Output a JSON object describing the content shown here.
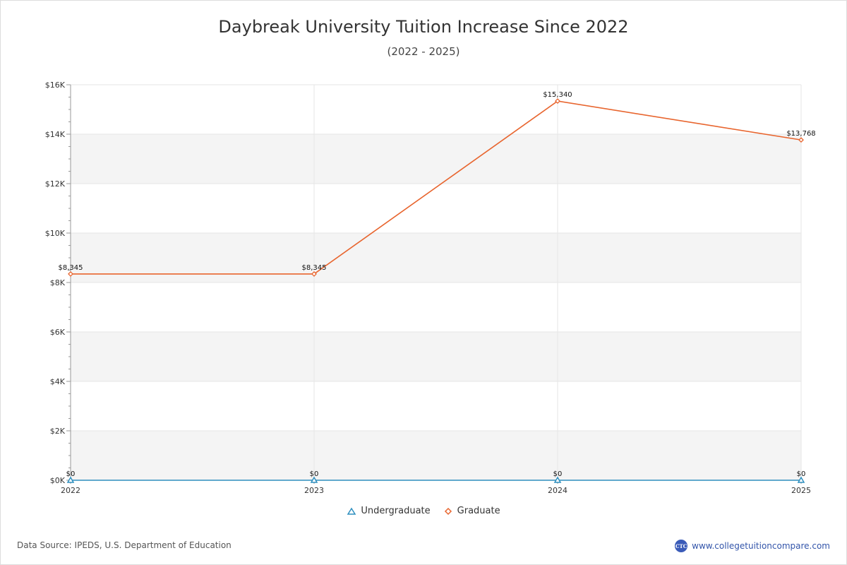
{
  "chart_data": {
    "type": "line",
    "title": "Daybreak University Tuition Increase Since 2022",
    "subtitle": "(2022 - 2025)",
    "x": [
      "2022",
      "2023",
      "2024",
      "2025"
    ],
    "ylim": [
      0,
      16000
    ],
    "y_ticks": [
      "$0K",
      "$2K",
      "$4K",
      "$6K",
      "$8K",
      "$10K",
      "$12K",
      "$14K",
      "$16K"
    ],
    "grid": true,
    "legend_position": "bottom-center",
    "series": [
      {
        "name": "Undergraduate",
        "color": "#2e8fbf",
        "marker": "triangle",
        "values": [
          0,
          0,
          0,
          0
        ],
        "labels": [
          "$0",
          "$0",
          "$0",
          "$0"
        ]
      },
      {
        "name": "Graduate",
        "color": "#e8652e",
        "marker": "diamond",
        "values": [
          8345,
          8345,
          15340,
          13768
        ],
        "labels": [
          "$8,345",
          "$8,345",
          "$15,340",
          "$13,768"
        ]
      }
    ]
  },
  "footer": {
    "source": "Data Source: IPEDS, U.S. Department of Education",
    "brand_logo": "CTC",
    "brand_url": "www.collegetuitioncompare.com"
  }
}
